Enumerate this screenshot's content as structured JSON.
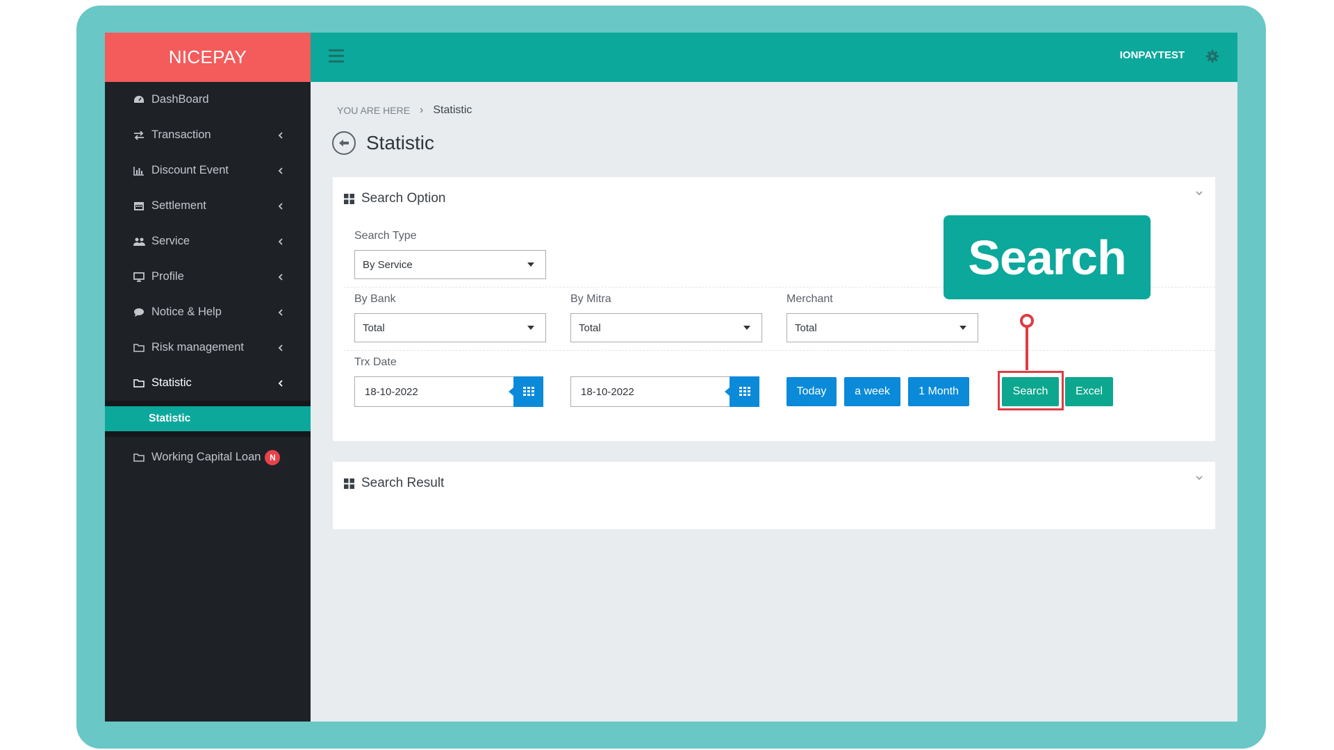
{
  "brand": {
    "name": "NICEPAY"
  },
  "colors": {
    "accent": "#0ba89b",
    "brand_red": "#f45b5b",
    "sidebar_bg": "#1e2227",
    "blue_button": "#0a8ad8",
    "frame": "#69c7c6",
    "highlight": "#dd3c44"
  },
  "sidebar": {
    "items": [
      {
        "label": "DashBoard",
        "icon": "dashboard-icon"
      },
      {
        "label": "Transaction",
        "icon": "exchange-icon"
      },
      {
        "label": "Discount Event",
        "icon": "bar-chart-icon"
      },
      {
        "label": "Settlement",
        "icon": "calendar-icon"
      },
      {
        "label": "Service",
        "icon": "users-icon"
      },
      {
        "label": "Profile",
        "icon": "monitor-icon"
      },
      {
        "label": "Notice & Help",
        "icon": "comment-icon"
      },
      {
        "label": "Risk management",
        "icon": "folder-icon"
      },
      {
        "label": "Statistic",
        "icon": "folder-icon"
      }
    ],
    "sub_item": {
      "label": "Statistic"
    },
    "extra_item": {
      "label": "Working Capital Loan",
      "badge": "N",
      "icon": "folder-icon"
    }
  },
  "topbar": {
    "user": "IONPAYTEST",
    "menu_icon": "hamburger-icon",
    "settings_icon": "gear-icon"
  },
  "breadcrumb": {
    "prefix": "YOU ARE HERE",
    "current": "Statistic"
  },
  "page": {
    "title": "Statistic"
  },
  "search_panel": {
    "title": "Search Option",
    "search_type": {
      "label": "Search Type",
      "value": "By Service"
    },
    "by_bank": {
      "label": "By Bank",
      "value": "Total"
    },
    "by_mitra": {
      "label": "By Mitra",
      "value": "Total"
    },
    "merchant": {
      "label": "Merchant",
      "value": "Total"
    },
    "trx_date": {
      "label": "Trx Date",
      "from": "18-10-2022",
      "to": "18-10-2022"
    },
    "buttons": {
      "today": "Today",
      "week": "a week",
      "month": "1 Month",
      "search": "Search",
      "excel": "Excel"
    }
  },
  "result_panel": {
    "title": "Search Result"
  },
  "callout": {
    "text": "Search"
  }
}
